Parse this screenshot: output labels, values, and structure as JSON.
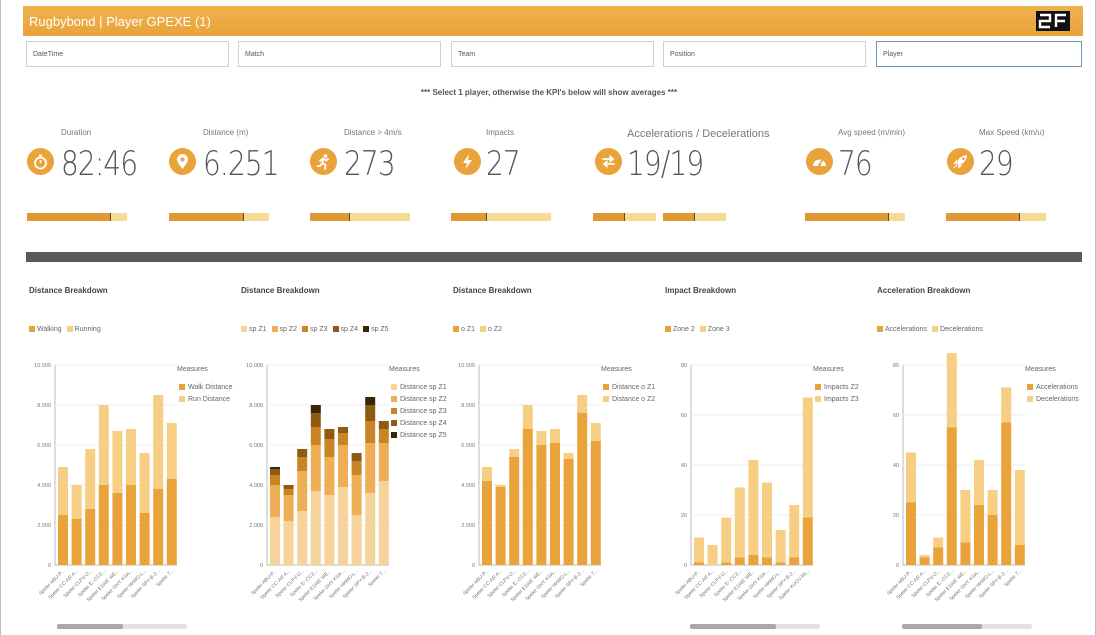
{
  "app": {
    "title": "Rugbybond | Player GPEXE (1)"
  },
  "colors": {
    "accent": "#e9a33a",
    "light": "#f6cf84",
    "dark_divider": "#5a5a5a"
  },
  "filters": [
    {
      "label": "DateTime"
    },
    {
      "label": "Match"
    },
    {
      "label": "Team"
    },
    {
      "label": "Position"
    },
    {
      "label": "Player"
    }
  ],
  "notice": "*** Select 1 player, otherwise the KPI's below will show averages ***",
  "kpis": [
    {
      "label": "Duration",
      "value": "82:46",
      "icon": "stopwatch-icon",
      "progress": [
        0.84
      ]
    },
    {
      "label": "Distance (m)",
      "value": "6.251",
      "icon": "location-pin-icon",
      "progress": [
        0.75
      ]
    },
    {
      "label": "Distance > 4m/s",
      "value": "273",
      "icon": "running-man-icon",
      "progress": [
        0.4
      ]
    },
    {
      "label": "Impacts",
      "value": "27",
      "icon": "lightning-icon",
      "progress": [
        0.36
      ]
    },
    {
      "label": "Accelerations / Decelerations",
      "value": "19/19",
      "icon": "acceleration-arrows-icon",
      "progress": [
        0.5,
        0.5
      ]
    },
    {
      "label": "Avg speed (m/min)",
      "value": "76",
      "icon": "speedometer-icon",
      "progress": [
        0.84
      ]
    },
    {
      "label": "Max Speed (km/u)",
      "value": "29",
      "icon": "rocket-icon",
      "progress": [
        0.74
      ]
    }
  ],
  "players": [
    "Speler ABU-P...",
    "Speler CC-AR A...",
    "Speler CLPV-U...",
    "Speler E--CCZ...",
    "Speler E1WE WE...",
    "Speler GHY KSA...",
    "Speler HKMD-L...",
    "Speler SPY-B-2...",
    "Speler T..."
  ],
  "charts": [
    {
      "title": "Distance Breakdown",
      "legend": [
        "Walking",
        "Running"
      ],
      "measures_title": "Measures",
      "measures": [
        "Walk Distance",
        "Run Distance"
      ],
      "colors": [
        "#e9a33a",
        "#f6cf84"
      ],
      "chart_data": {
        "type": "bar",
        "stacked": true,
        "ylim": [
          0,
          10000
        ],
        "y_ticks": [
          "0",
          "2.000",
          "4.000",
          "6.000",
          "8.000",
          "10.000"
        ],
        "categories": [
          "Speler ABU-P...",
          "Speler CC-AR A...",
          "Speler CLPV-U...",
          "Speler E--CCZ...",
          "Speler E1WE WE...",
          "Speler GHY KSA...",
          "Speler HKMD-L...",
          "Speler SPY-B-2...",
          "Speler T..."
        ],
        "series": [
          {
            "name": "Walk Distance",
            "values": [
              2500,
              2300,
              2800,
              4000,
              3600,
              4000,
              2600,
              3800,
              4300
            ]
          },
          {
            "name": "Run Distance",
            "values": [
              2400,
              1700,
              3000,
              4000,
              3100,
              2800,
              3000,
              4700,
              2800
            ]
          }
        ]
      }
    },
    {
      "title": "Distance Breakdown",
      "legend": [
        "sp Z1",
        "sp Z2",
        "sp Z3",
        "sp Z4",
        "sp Z5"
      ],
      "measures_title": "Measures",
      "measures": [
        "Distance sp Z1",
        "Distance sp Z2",
        "Distance sp Z3",
        "Distance sp Z4",
        "Distance sp Z5"
      ],
      "colors": [
        "#f6d39a",
        "#edae55",
        "#c88425",
        "#8f5b14",
        "#3a2508"
      ],
      "chart_data": {
        "type": "bar",
        "stacked": true,
        "ylim": [
          0,
          10000
        ],
        "y_ticks": [
          "0",
          "2.000",
          "4.000",
          "6.000",
          "8.000",
          "10.000"
        ],
        "categories": [
          "Speler ABU-P...",
          "Speler CC-AR A...",
          "Speler CLPV-U...",
          "Speler E--CCZ...",
          "Speler E1WE WE...",
          "Speler GHY KSA...",
          "Speler HKMD-L...",
          "Speler SPY-B-2...",
          "Speler T..."
        ],
        "series": [
          {
            "name": "Distance sp Z1",
            "values": [
              2400,
              2200,
              2700,
              3700,
              3500,
              3900,
              2500,
              3600,
              4200
            ]
          },
          {
            "name": "Distance sp Z2",
            "values": [
              1600,
              1300,
              2000,
              2300,
              1900,
              2100,
              2000,
              2500,
              1900
            ]
          },
          {
            "name": "Distance sp Z3",
            "values": [
              500,
              300,
              700,
              900,
              900,
              600,
              700,
              1100,
              700
            ]
          },
          {
            "name": "Distance sp Z4",
            "values": [
              300,
              200,
              400,
              700,
              500,
              300,
              400,
              800,
              400
            ]
          },
          {
            "name": "Distance sp Z5",
            "values": [
              100,
              0,
              0,
              400,
              0,
              0,
              0,
              400,
              0
            ]
          }
        ]
      }
    },
    {
      "title": "Distance Breakdown",
      "legend": [
        "o Z1",
        "o Z2"
      ],
      "measures_title": "Measures",
      "measures": [
        "Distance o Z1",
        "Distance o Z2"
      ],
      "colors": [
        "#e9a33a",
        "#f6cf84"
      ],
      "chart_data": {
        "type": "bar",
        "stacked": true,
        "ylim": [
          0,
          10000
        ],
        "y_ticks": [
          "0",
          "2.000",
          "4.000",
          "6.000",
          "8.000",
          "10.000"
        ],
        "categories": [
          "Speler ABU-P...",
          "Speler CC-AR A...",
          "Speler CLPV-U...",
          "Speler E--CCZ...",
          "Speler E1WE WE...",
          "Speler GHY KSA...",
          "Speler HKMD-L...",
          "Speler SPY-B-2...",
          "Speler T..."
        ],
        "series": [
          {
            "name": "Distance o Z1",
            "values": [
              4200,
              3900,
              5400,
              6800,
              6000,
              6100,
              5300,
              7600,
              6200
            ]
          },
          {
            "name": "Distance o Z2",
            "values": [
              700,
              100,
              400,
              1200,
              700,
              700,
              300,
              900,
              900
            ]
          }
        ]
      }
    },
    {
      "title": "Impact Breakdown",
      "legend": [
        "Zone 2",
        "Zone 3"
      ],
      "measures_title": "Measures",
      "measures": [
        "Impacts Z2",
        "Impacts Z3"
      ],
      "colors": [
        "#e9a33a",
        "#f6cf84"
      ],
      "chart_data": {
        "type": "bar",
        "stacked": true,
        "ylim": [
          0,
          80
        ],
        "y_ticks": [
          "0",
          "20",
          "40",
          "60",
          "80"
        ],
        "categories": [
          "Speler ABU-P...",
          "Speler CC-AR A...",
          "Speler CLPV-U...",
          "Speler E--CCZ...",
          "Speler E1WE WE...",
          "Speler GHY KSA...",
          "Speler HKMD-L...",
          "Speler SPY-B-2...",
          "Speler KUOV-bb..."
        ],
        "series": [
          {
            "name": "Impacts Z2",
            "values": [
              1,
              0,
              1,
              3,
              4,
              3,
              1,
              3,
              19
            ]
          },
          {
            "name": "Impacts Z3",
            "values": [
              10,
              8,
              18,
              28,
              38,
              30,
              13,
              21,
              48
            ]
          }
        ]
      }
    },
    {
      "title": "Acceleration Breakdown",
      "legend": [
        "Accelerations",
        "Decelerations"
      ],
      "measures_title": "Measures",
      "measures": [
        "Accelerations",
        "Decelerations"
      ],
      "colors": [
        "#e9a33a",
        "#f6cf84"
      ],
      "chart_data": {
        "type": "bar",
        "stacked": true,
        "ylim": [
          0,
          80
        ],
        "y_ticks": [
          "0",
          "20",
          "40",
          "60",
          "80"
        ],
        "categories": [
          "Speler ABU-P...",
          "Speler CC-AR A...",
          "Speler CLPV-U...",
          "Speler E--CCZ...",
          "Speler E1WE WE...",
          "Speler GHY KSA...",
          "Speler HKMD-L...",
          "Speler SPY-B-2...",
          "Speler T..."
        ],
        "series": [
          {
            "name": "Accelerations",
            "values": [
              25,
              3,
              7,
              55,
              9,
              24,
              20,
              57,
              8
            ]
          },
          {
            "name": "Decelerations",
            "values": [
              20,
              1,
              4,
              30,
              21,
              18,
              10,
              14,
              30
            ]
          }
        ]
      }
    }
  ]
}
